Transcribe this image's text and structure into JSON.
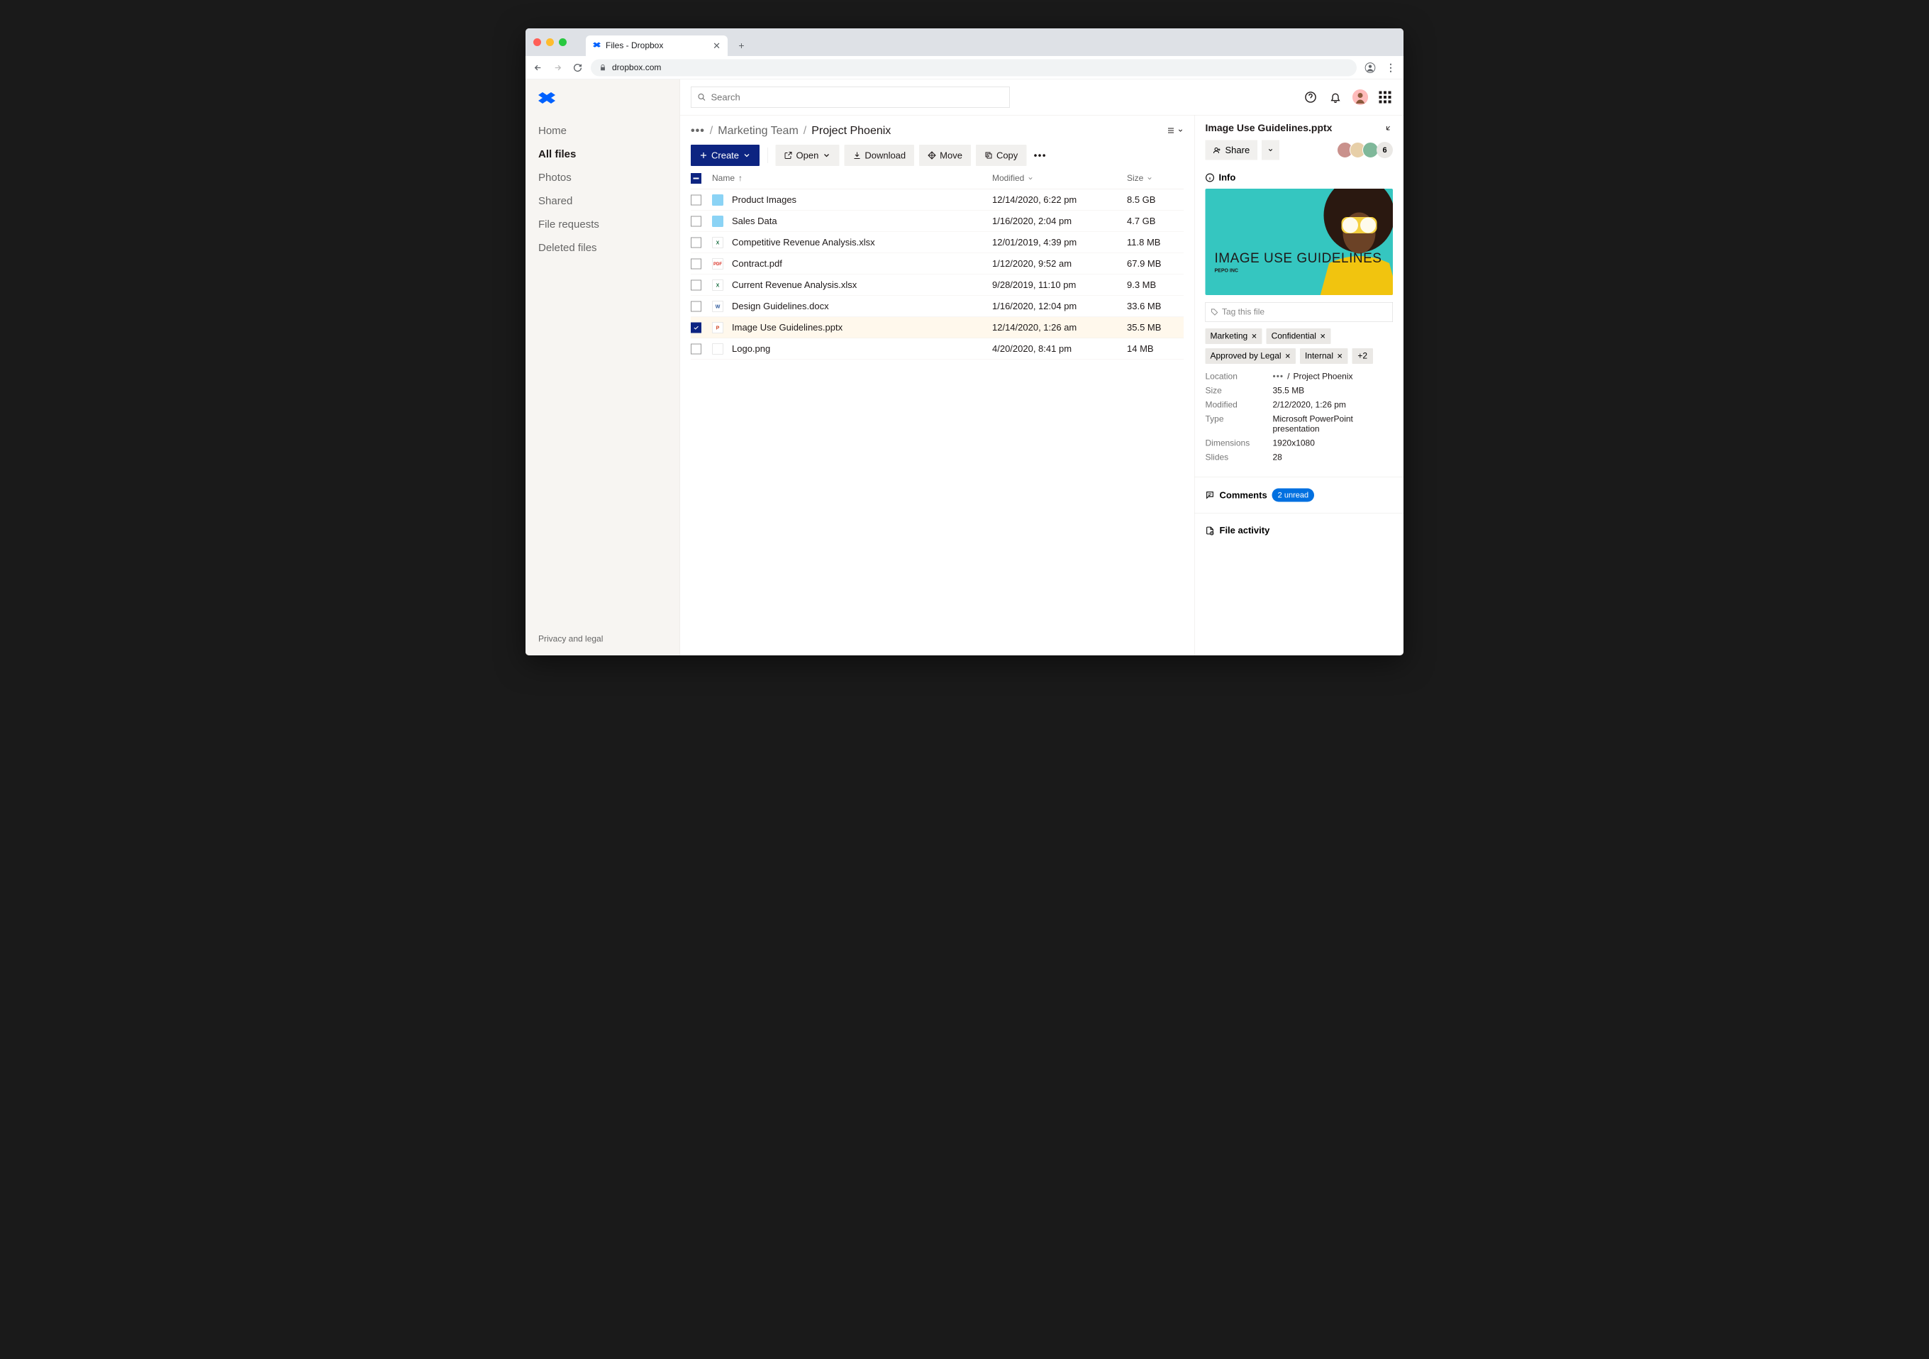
{
  "browser": {
    "tabTitle": "Files - Dropbox",
    "url": "dropbox.com"
  },
  "sidebar": {
    "items": [
      "Home",
      "All files",
      "Photos",
      "Shared",
      "File requests",
      "Deleted files"
    ],
    "activeIndex": 1,
    "footer": "Privacy and legal"
  },
  "header": {
    "searchPlaceholder": "Search"
  },
  "breadcrumb": {
    "ellipsis": "•••",
    "parent": "Marketing Team",
    "current": "Project Phoenix"
  },
  "toolbar": {
    "create": "Create",
    "open": "Open",
    "download": "Download",
    "move": "Move",
    "copy": "Copy"
  },
  "columns": {
    "name": "Name",
    "modified": "Modified",
    "size": "Size"
  },
  "files": [
    {
      "type": "folder",
      "name": "Product Images",
      "modified": "12/14/2020, 6:22 pm",
      "size": "8.5 GB",
      "selected": false
    },
    {
      "type": "folder",
      "name": "Sales Data",
      "modified": "1/16/2020, 2:04 pm",
      "size": "4.7 GB",
      "selected": false
    },
    {
      "type": "xls",
      "name": "Competitive Revenue Analysis.xlsx",
      "modified": "12/01/2019, 4:39 pm",
      "size": "11.8 MB",
      "selected": false
    },
    {
      "type": "pdf",
      "name": "Contract.pdf",
      "modified": "1/12/2020, 9:52 am",
      "size": "67.9 MB",
      "selected": false
    },
    {
      "type": "xls",
      "name": "Current Revenue Analysis.xlsx",
      "modified": "9/28/2019, 11:10 pm",
      "size": "9.3 MB",
      "selected": false
    },
    {
      "type": "doc",
      "name": "Design Guidelines.docx",
      "modified": "1/16/2020, 12:04 pm",
      "size": "33.6 MB",
      "selected": false
    },
    {
      "type": "ppt",
      "name": "Image Use Guidelines.pptx",
      "modified": "12/14/2020, 1:26 am",
      "size": "35.5 MB",
      "selected": true
    },
    {
      "type": "img",
      "name": "Logo.png",
      "modified": "4/20/2020, 8:41 pm",
      "size": "14 MB",
      "selected": false
    }
  ],
  "details": {
    "title": "Image Use Guidelines.pptx",
    "shareLabel": "Share",
    "memberCount": "6",
    "infoLabel": "Info",
    "previewTitle": "IMAGE USE GUIDELINES",
    "previewSub": "PEPO INC",
    "tagPlaceholder": "Tag this file",
    "tags": [
      "Marketing",
      "Confidential",
      "Approved by Legal",
      "Internal"
    ],
    "tagsMore": "+2",
    "meta": {
      "locationLabel": "Location",
      "locationValue": "Project Phoenix",
      "sizeLabel": "Size",
      "sizeValue": "35.5 MB",
      "modifiedLabel": "Modified",
      "modifiedValue": "2/12/2020, 1:26 pm",
      "typeLabel": "Type",
      "typeValue": "Microsoft PowerPoint presentation",
      "dimensionsLabel": "Dimensions",
      "dimensionsValue": "1920x1080",
      "slidesLabel": "Slides",
      "slidesValue": "28"
    },
    "commentsLabel": "Comments",
    "commentsBadge": "2 unread",
    "activityLabel": "File activity"
  }
}
